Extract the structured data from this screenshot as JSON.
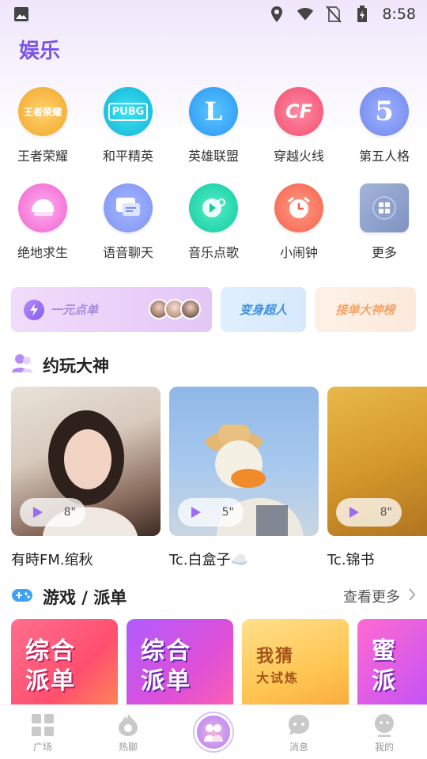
{
  "status_bar": {
    "time": "8:58",
    "icons": [
      "gallery-icon",
      "location-icon",
      "wifi-icon",
      "no-sim-icon",
      "battery-charging-icon"
    ]
  },
  "page": {
    "title": "娱乐"
  },
  "apps": [
    {
      "label": "王者荣耀",
      "icon": "honor-of-kings-icon",
      "badge": "王者荣耀"
    },
    {
      "label": "和平精英",
      "icon": "pubg-icon",
      "badge": "PUBG"
    },
    {
      "label": "英雄联盟",
      "icon": "league-of-legends-icon",
      "badge": "L"
    },
    {
      "label": "穿越火线",
      "icon": "crossfire-icon",
      "badge": "CF"
    },
    {
      "label": "第五人格",
      "icon": "identity-v-icon",
      "badge": "5"
    },
    {
      "label": "绝地求生",
      "icon": "helmet-icon",
      "badge": ""
    },
    {
      "label": "语音聊天",
      "icon": "chat-bubble-icon",
      "badge": ""
    },
    {
      "label": "音乐点歌",
      "icon": "music-icon",
      "badge": ""
    },
    {
      "label": "小闹钟",
      "icon": "alarm-clock-icon",
      "badge": ""
    },
    {
      "label": "更多",
      "icon": "more-grid-icon",
      "badge": ""
    }
  ],
  "banners": {
    "one_yuan": "一元点单",
    "transform": "变身超人",
    "ranking": "接单大神榜"
  },
  "section_players": {
    "title": "约玩大神"
  },
  "cards": [
    {
      "name": "有時FM.绾秋",
      "seconds": "8\""
    },
    {
      "name": "Tc.白盒子☁️",
      "seconds": "5\""
    },
    {
      "name": "Tc.锦书",
      "seconds": "8\""
    }
  ],
  "section_games": {
    "title": "游戏 / 派单",
    "more": "查看更多"
  },
  "tiles": [
    {
      "line1": "综合",
      "line2": "派单"
    },
    {
      "line1": "综合",
      "line2": "派单"
    },
    {
      "line1": "我猜",
      "line2": "大试炼"
    },
    {
      "line1": "蜜",
      "line2": "派"
    }
  ],
  "nav": [
    {
      "label": "广场",
      "icon": "square-grid-icon"
    },
    {
      "label": "热聊",
      "icon": "flame-chat-icon"
    },
    {
      "label": "",
      "icon": "center-couple-icon"
    },
    {
      "label": "消息",
      "icon": "message-icon"
    },
    {
      "label": "我的",
      "icon": "profile-icon"
    }
  ],
  "colors": {
    "accent": "#7b53e6",
    "tab_inactive": "#999999"
  }
}
